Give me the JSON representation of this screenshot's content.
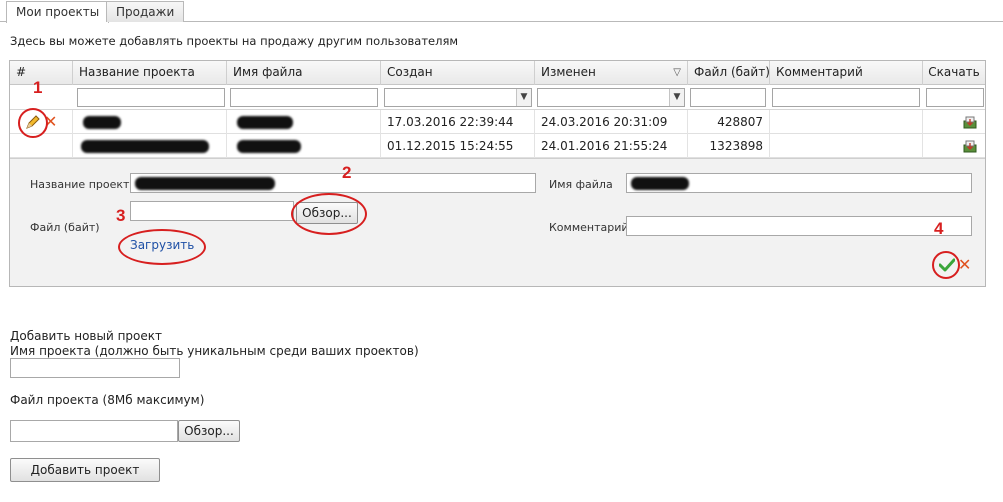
{
  "tabs": [
    {
      "label": "Мои проекты",
      "active": true
    },
    {
      "label": "Продажи",
      "active": false
    }
  ],
  "intro_text": "Здесь вы можете добавлять проекты на продажу другим пользователям",
  "table": {
    "headers": {
      "num": "#",
      "project_name": "Название проекта",
      "file_name": "Имя файла",
      "created": "Создан",
      "modified": "Изменен",
      "file_size": "Файл (байт)",
      "comment": "Комментарий",
      "download": "Скачать"
    },
    "rows": [
      {
        "created": "17.03.2016 22:39:44",
        "modified": "24.03.2016 20:31:09",
        "size": "428807",
        "comment": ""
      },
      {
        "created": "01.12.2015 15:24:55",
        "modified": "24.01.2016 21:55:24",
        "size": "1323898",
        "comment": ""
      }
    ]
  },
  "edit_form": {
    "project_name_label": "Название проекта",
    "file_name_label": "Имя файла",
    "file_size_label": "Файл (байт)",
    "comment_label": "Комментарий",
    "browse_button": "Обзор...",
    "upload_link": "Загрузить"
  },
  "annotations": [
    "1",
    "2",
    "3",
    "4"
  ],
  "add_project": {
    "title": "Добавить новый проект",
    "name_label": "Имя проекта (должно быть уникальным среди ваших проектов)",
    "file_label": "Файл проекта (8Мб максимум)",
    "browse_button": "Обзор...",
    "submit_button": "Добавить проект"
  },
  "colors": {
    "annotation": "#d71f1f",
    "link": "#1d4fa5",
    "cancel": "#e0521f",
    "confirm": "#3aa53a"
  }
}
